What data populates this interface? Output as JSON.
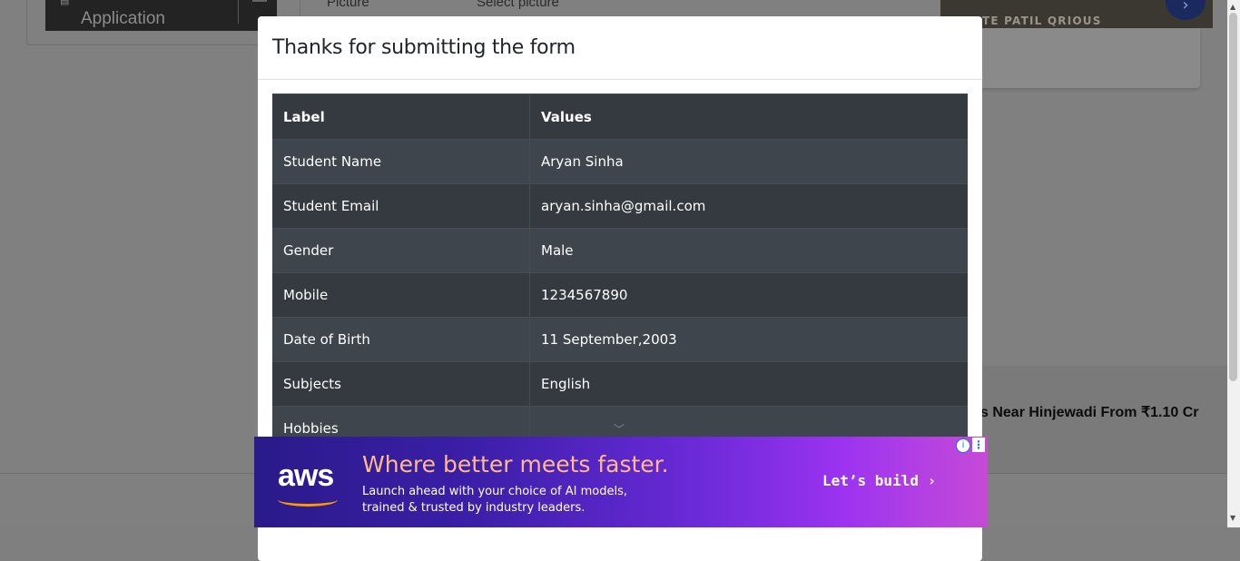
{
  "background": {
    "left_panel": {
      "app_label": "Application",
      "icon": "book-icon"
    },
    "form_fields": {
      "picture_label": "Picture",
      "picture_value": "Select picture"
    },
    "top_ad_text": "TE PATIL QRIOUS",
    "banner_text": "s Near Hinjewadi From ₹1.10 Cr"
  },
  "modal": {
    "title": "Thanks for submitting the form",
    "table": {
      "headers": [
        "Label",
        "Values"
      ],
      "rows": [
        {
          "label": "Student Name",
          "value": "Aryan Sinha"
        },
        {
          "label": "Student Email",
          "value": "aryan.sinha@gmail.com"
        },
        {
          "label": "Gender",
          "value": "Male"
        },
        {
          "label": "Mobile",
          "value": "1234567890"
        },
        {
          "label": "Date of Birth",
          "value": "11 September,2003"
        },
        {
          "label": "Subjects",
          "value": "English"
        },
        {
          "label": "Hobbies",
          "value": ""
        }
      ]
    }
  },
  "ad": {
    "brand": "aws",
    "headline": "Where better meets faster.",
    "subtext": "Launch ahead with your choice of AI models, trained & trusted by industry leaders.",
    "cta": "Let’s build ›",
    "colors": {
      "headline": "#ffb98a",
      "smile": "#ff9900"
    }
  }
}
